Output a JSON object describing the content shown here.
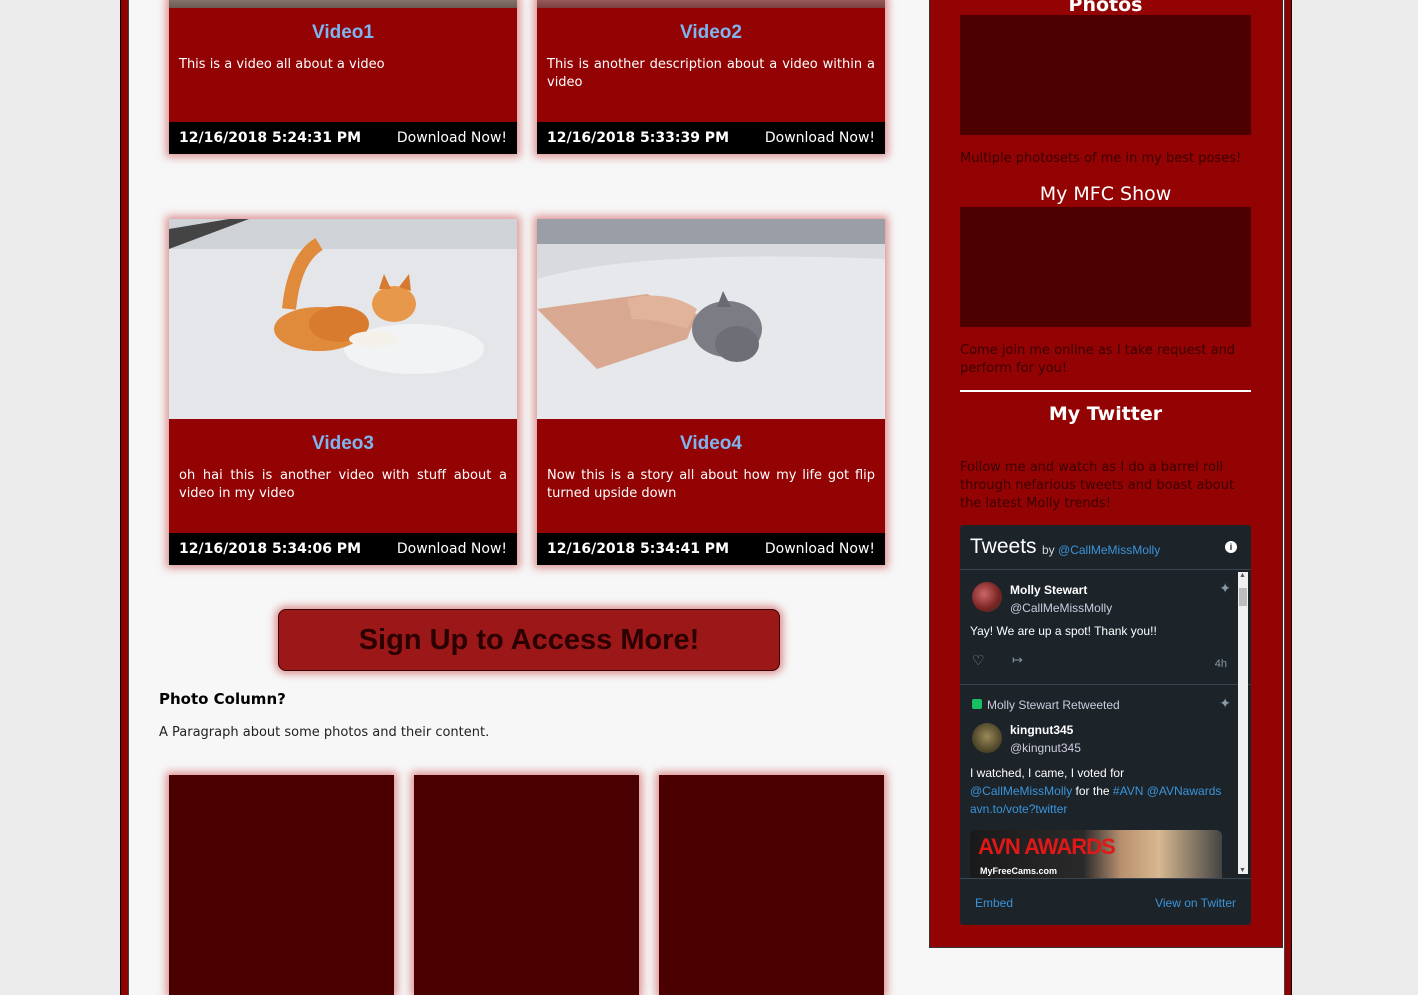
{
  "videos": [
    {
      "title": "Video1",
      "description": "This is a video all about a video",
      "date": "12/16/2018 5:24:31 PM",
      "download": "Download Now!"
    },
    {
      "title": "Video2",
      "description": "This is another description about a video within a video",
      "date": "12/16/2018 5:33:39 PM",
      "download": "Download Now!"
    },
    {
      "title": "Video3",
      "description": "oh hai this is another video with stuff about a video in my video",
      "date": "12/16/2018 5:34:06 PM",
      "download": "Download Now!"
    },
    {
      "title": "Video4",
      "description": "Now this is a story all about how my life got flip turned upside down",
      "date": "12/16/2018 5:34:41 PM",
      "download": "Download Now!"
    }
  ],
  "signup_label": "Sign Up to Access More!",
  "photo_section": {
    "heading": "Photo Column?",
    "paragraph": "A Paragraph about some photos and their content."
  },
  "sidebar": {
    "photos_title": "Photos",
    "photos_text": "Multiple photosets of me in my best poses!",
    "mfc_title": "My MFC Show",
    "mfc_text": "Come join me online as I take request and perform for you!",
    "twitter_title": "My Twitter",
    "twitter_text": "Follow me and watch as I do a barrel roll through nefarious tweets and boast about the latest Molly trends!"
  },
  "twitter_widget": {
    "heading": "Tweets",
    "by": "by",
    "handle": "@CallMeMissMolly",
    "tweet1": {
      "name": "Molly Stewart",
      "handle": "@CallMeMissMolly",
      "text": "Yay! We are up a spot! Thank you!!",
      "time": "4h"
    },
    "tweet2": {
      "retweet_label": "Molly Stewart Retweeted",
      "name": "kingnut345",
      "handle": "@kingnut345",
      "text_a": "I watched, I came, I voted for",
      "mention1": "@CallMeMissMolly",
      "text_b": "for the",
      "hashtag": "#AVN",
      "mention2": "@AVNawards",
      "link": "avn.to/vote?twitter",
      "media_logo": "AVN AWARDS",
      "media_sub": "MyFreeCams.com"
    },
    "footer": {
      "embed": "Embed",
      "view": "View on Twitter"
    }
  }
}
